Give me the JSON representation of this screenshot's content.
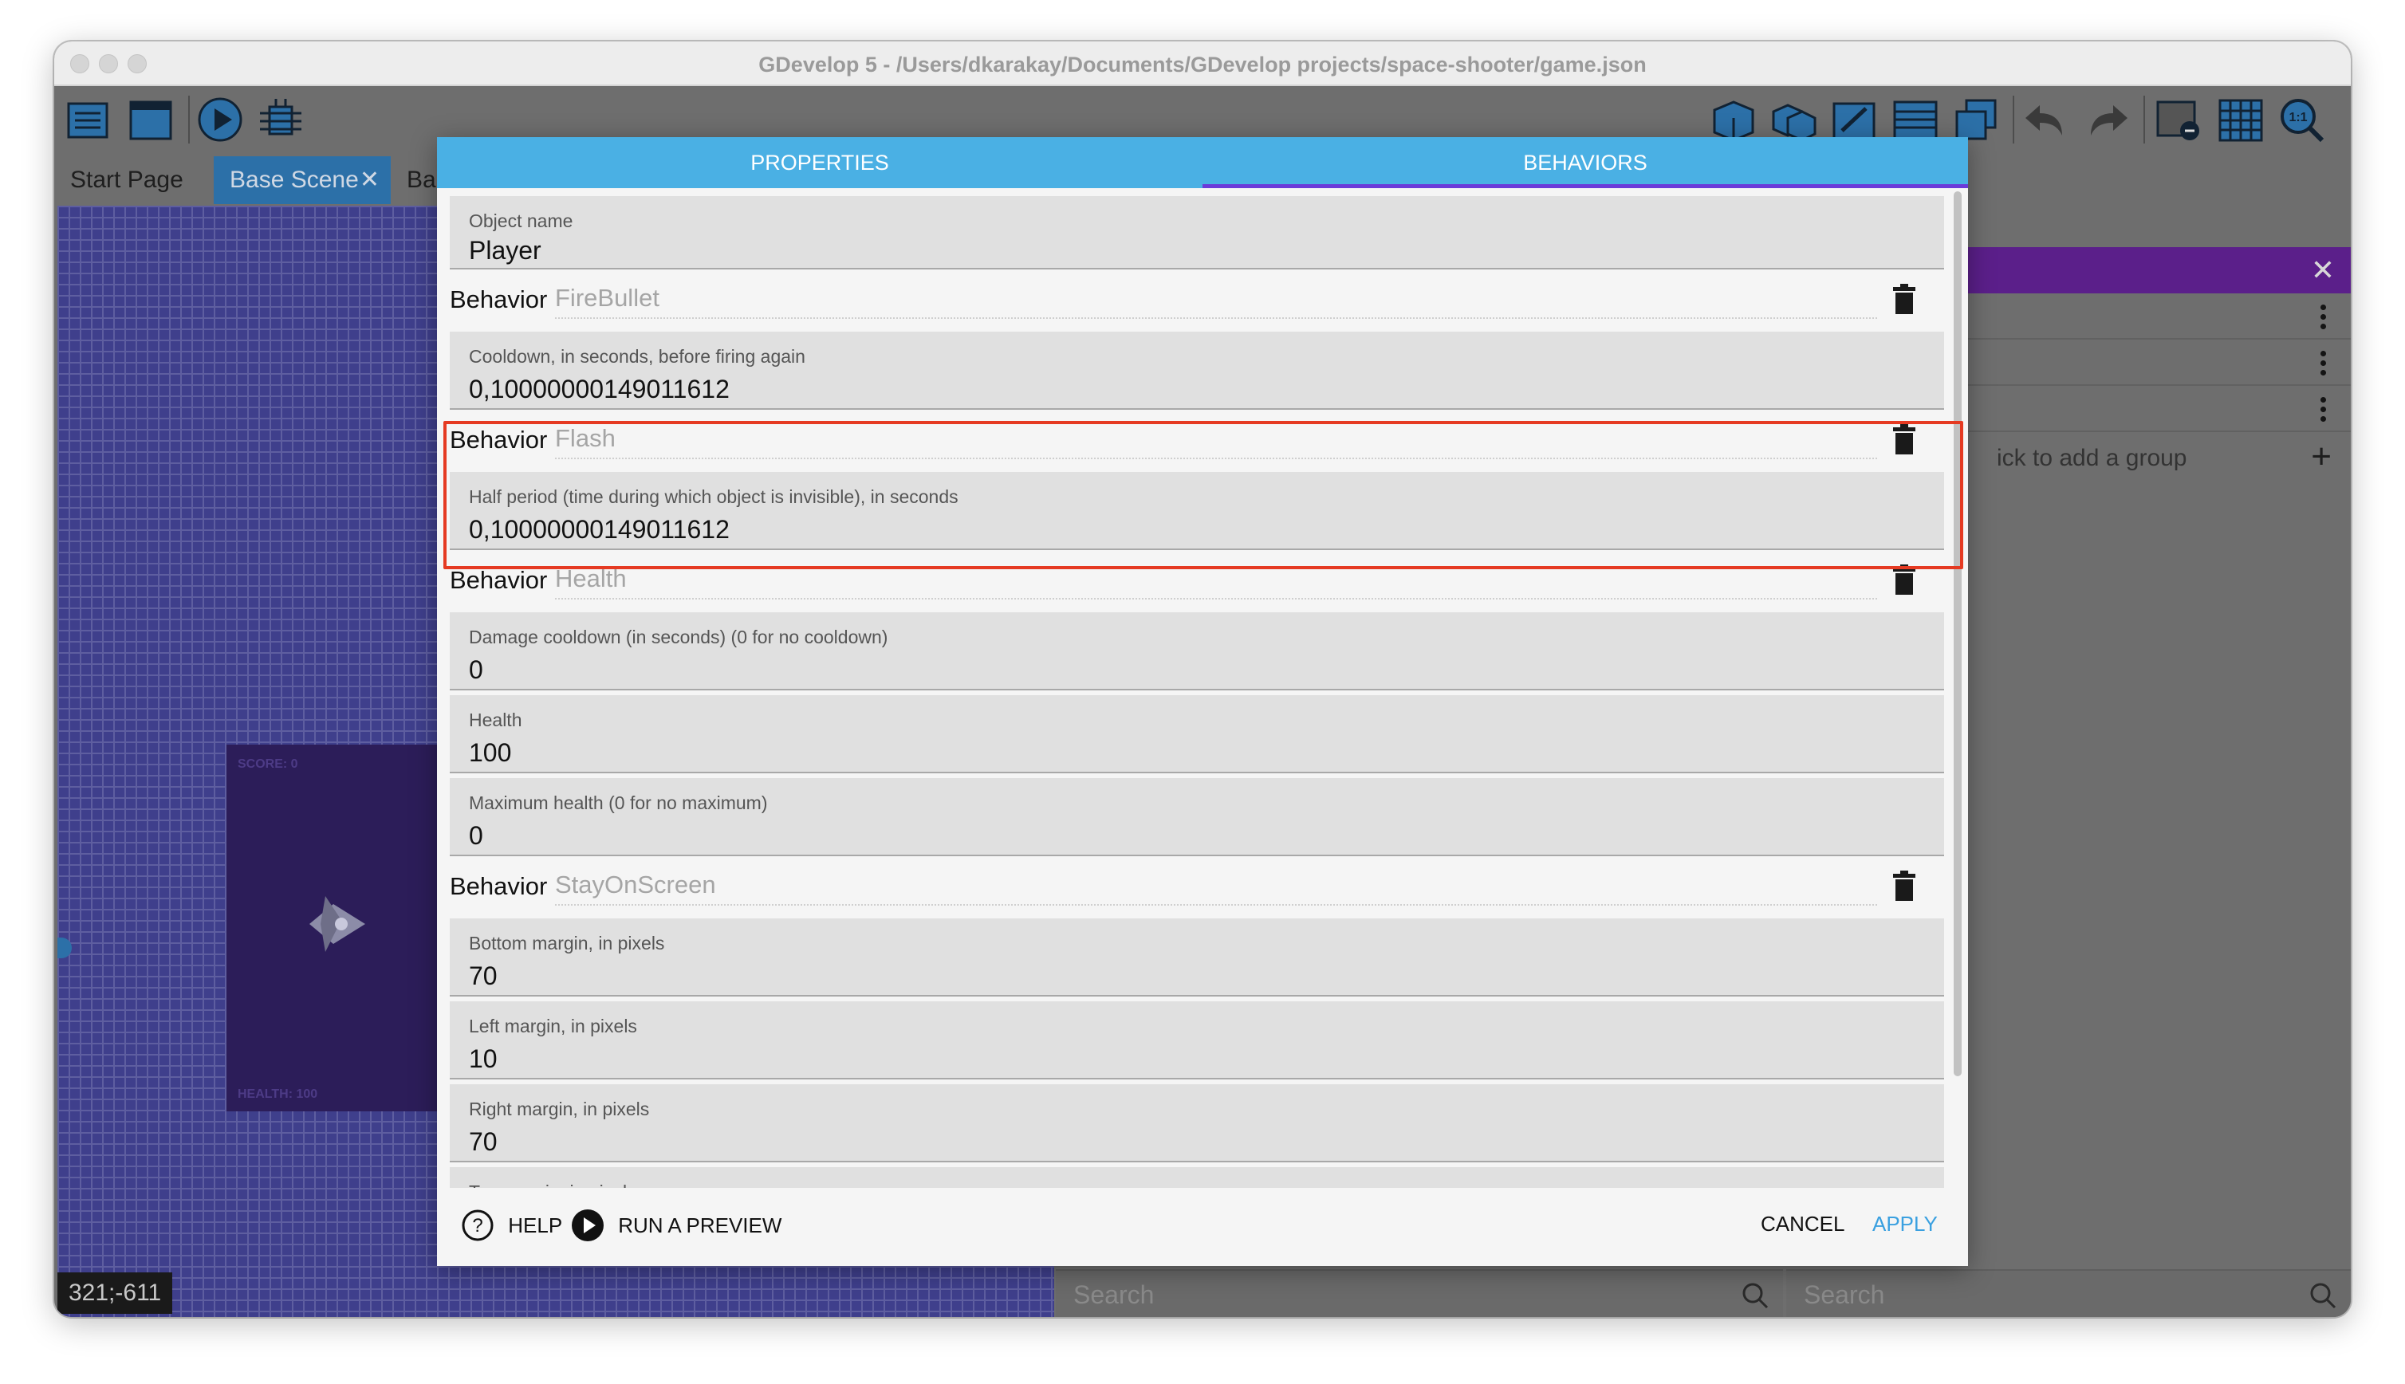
{
  "window": {
    "title": "GDevelop 5 - /Users/dkarakay/Documents/GDevelop projects/space-shooter/game.json"
  },
  "toolbar": {
    "left_icons": [
      "project-manager-icon",
      "scene-icon",
      "preview-play-icon",
      "debugger-icon"
    ],
    "right_icons": [
      "objects-panel-icon",
      "object-groups-icon",
      "properties-icon",
      "layers-icon",
      "instances-list-icon",
      "undo-icon",
      "redo-icon",
      "editor-settings-icon",
      "grid-icon",
      "zoom-icon"
    ]
  },
  "tabs": [
    {
      "label": "Start Page",
      "active": false
    },
    {
      "label": "Base Scene",
      "active": true
    },
    {
      "label": "Ba",
      "active": false
    }
  ],
  "canvas": {
    "coords": "321;-611",
    "game_labels": {
      "score": "SCORE: 0",
      "health": "HEALTH: 100"
    }
  },
  "right_panel": {
    "add_group": "ick to add a group",
    "search_left_placeholder": "Search",
    "search_right_placeholder": "Search"
  },
  "dialog": {
    "tabs": {
      "properties": "PROPERTIES",
      "behaviors": "BEHAVIORS"
    },
    "object_name_label": "Object name",
    "object_name_value": "Player",
    "behavior_word": "Behavior",
    "behaviors": [
      {
        "name": "FireBullet",
        "fields": [
          {
            "label": "Cooldown, in seconds, before firing again",
            "value": "0,10000000149011612"
          }
        ]
      },
      {
        "name": "Flash",
        "fields": [
          {
            "label": "Half period (time during which object is invisible), in seconds",
            "value": "0,10000000149011612"
          }
        ]
      },
      {
        "name": "Health",
        "fields": [
          {
            "label": "Damage cooldown (in seconds) (0 for no cooldown)",
            "value": "0"
          },
          {
            "label": "Health",
            "value": "100"
          },
          {
            "label": "Maximum health (0 for no maximum)",
            "value": "0"
          }
        ]
      },
      {
        "name": "StayOnScreen",
        "fields": [
          {
            "label": "Bottom margin, in pixels",
            "value": "70"
          },
          {
            "label": "Left margin, in pixels",
            "value": "10"
          },
          {
            "label": "Right margin, in pixels",
            "value": "70"
          },
          {
            "label": "Top margin, in pixels",
            "value": ""
          }
        ]
      }
    ],
    "footer": {
      "help": "HELP",
      "run_preview": "RUN A PREVIEW",
      "cancel": "CANCEL",
      "apply": "APPLY"
    }
  },
  "colors": {
    "dialog_tab_bar": "#4ab0e4",
    "tab_underline": "#6b3ad9",
    "highlight": "#e53a22",
    "apply": "#3aa0e0",
    "panel_header": "#5b1f8a"
  }
}
